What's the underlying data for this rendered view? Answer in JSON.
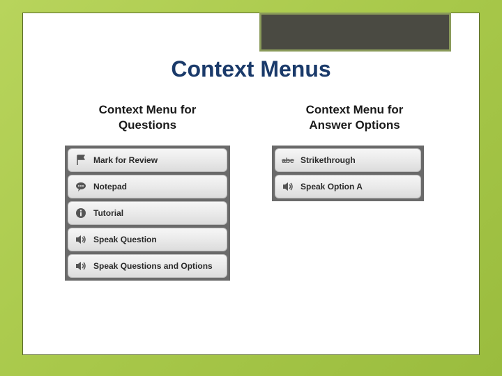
{
  "title": "Context Menus",
  "columns": {
    "left": {
      "heading_line1": "Context Menu for",
      "heading_line2": "Questions",
      "items": [
        {
          "icon": "flag-icon",
          "label": "Mark for Review"
        },
        {
          "icon": "speech-icon",
          "label": "Notepad"
        },
        {
          "icon": "info-icon",
          "label": "Tutorial"
        },
        {
          "icon": "speaker-icon",
          "label": "Speak Question"
        },
        {
          "icon": "speaker-icon",
          "label": "Speak Questions and Options"
        }
      ]
    },
    "right": {
      "heading_line1": "Context Menu for",
      "heading_line2": "Answer Options",
      "items": [
        {
          "icon": "strikethrough-icon",
          "label": "Strikethrough"
        },
        {
          "icon": "speaker-icon",
          "label": "Speak Option A"
        }
      ]
    }
  }
}
